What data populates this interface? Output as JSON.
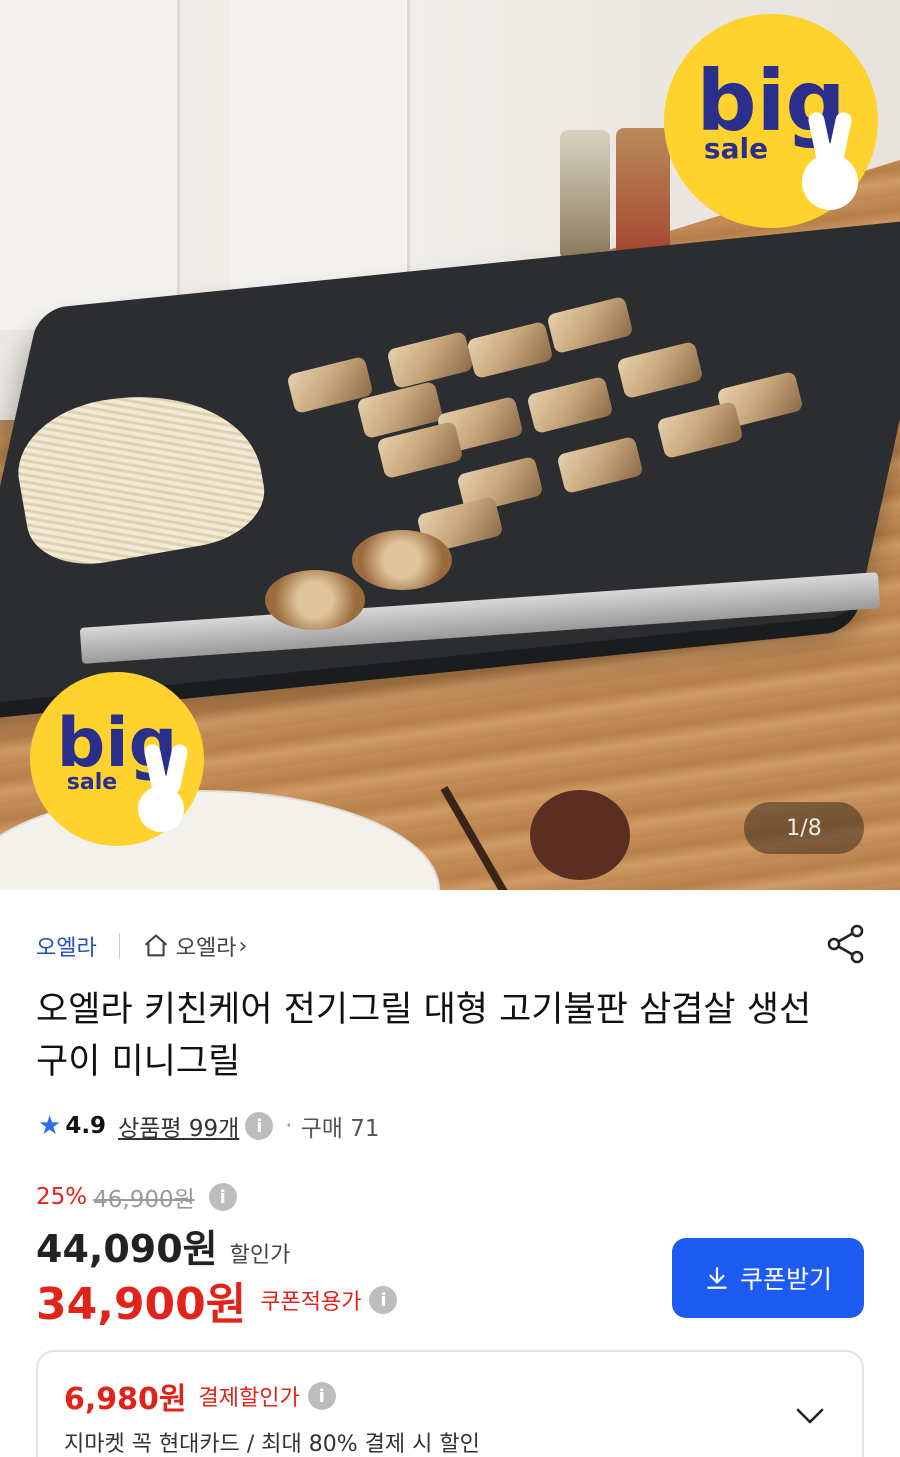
{
  "hero": {
    "badge_top_big": "big",
    "badge_top_sale": "sale",
    "badge_bottom_big": "big",
    "badge_bottom_sale": "sale",
    "image_counter": "1/8"
  },
  "store": {
    "name": "오엘라",
    "home_label": "오엘라",
    "chevron": "›"
  },
  "product": {
    "title": "오엘라 키친케어 전기그릴 대형 고기불판 삼겹살 생선구이 미니그릴",
    "rating": "4.9",
    "reviews_label": "상품평 99개",
    "purchases_label": "구매 71"
  },
  "price": {
    "discount_rate": "25%",
    "original_price": "46,900원",
    "sale_price": "44,090원",
    "sale_label": "할인가",
    "coupon_price": "34,900원",
    "coupon_label": "쿠폰적용가",
    "coupon_button": "쿠폰받기"
  },
  "payment": {
    "price": "6,980원",
    "label": "결제할인가",
    "description": "지마켓 꼭 현대카드 / 최대 80% 결제 시 할인"
  },
  "colors": {
    "accent_blue": "#1d5cf2",
    "price_red": "#e2231a",
    "badge_yellow": "#ffd22e",
    "star_blue": "#2a6ef0"
  },
  "icons": {
    "share": "share-icon",
    "home": "home-icon",
    "info": "info-icon",
    "download": "download-icon",
    "expand": "chevron-down-icon",
    "star": "star-icon"
  }
}
